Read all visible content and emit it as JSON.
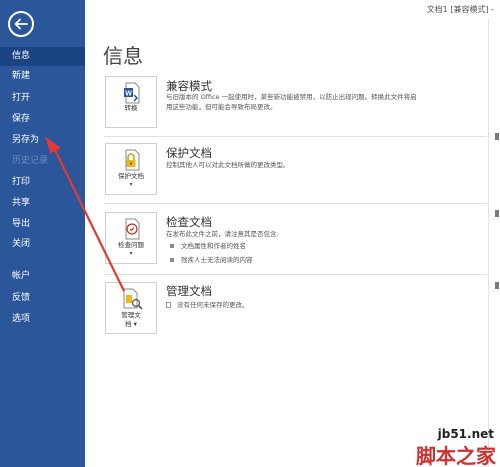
{
  "window": {
    "title": "文档1 [兼容模式] -"
  },
  "sidebar": {
    "items": [
      {
        "label": "信息"
      },
      {
        "label": "新建"
      },
      {
        "label": "打开"
      },
      {
        "label": "保存"
      },
      {
        "label": "另存为"
      },
      {
        "label": "历史记录"
      },
      {
        "label": "打印"
      },
      {
        "label": "共享"
      },
      {
        "label": "导出"
      },
      {
        "label": "关闭"
      },
      {
        "label": "帐户"
      },
      {
        "label": "反馈"
      },
      {
        "label": "选项"
      }
    ]
  },
  "main": {
    "title": "信息",
    "sections": [
      {
        "button_label": "转换",
        "title": "兼容模式",
        "desc1": "与旧版本的 Office 一起使用时，某些新功能被禁用，以防止出现问题。转换此文件将启",
        "desc2": "用这些功能，但可能会导致布局更改。"
      },
      {
        "button_label": "保护文档",
        "button_caret": "▾",
        "title": "保护文档",
        "desc1": "控制其他人可以对此文档所做的更改类型。"
      },
      {
        "button_label": "检查问题",
        "button_caret": "▾",
        "title": "检查文档",
        "desc1": "在发布此文件之前，请注意其是否包含:",
        "bullets": [
          "文档属性和作者的姓名",
          "残疾人士无法阅读的内容"
        ]
      },
      {
        "button_label1": "管理文",
        "button_label2": "档 ▾",
        "title": "管理文档",
        "desc1": "没有任何未保存的更改。"
      }
    ]
  },
  "watermark": {
    "line1": "jb51.net",
    "line2": "脚本之家"
  },
  "colors": {
    "sidebar": "#2b579a",
    "active_item": "#1a4483",
    "arrow": "#e53935",
    "watermark": "#d0302f"
  },
  "icons": {
    "back": "back-arrow-icon",
    "convert": "word-convert-icon",
    "protect": "lock-key-icon",
    "inspect": "inspect-document-icon",
    "manage": "manage-document-icon"
  }
}
